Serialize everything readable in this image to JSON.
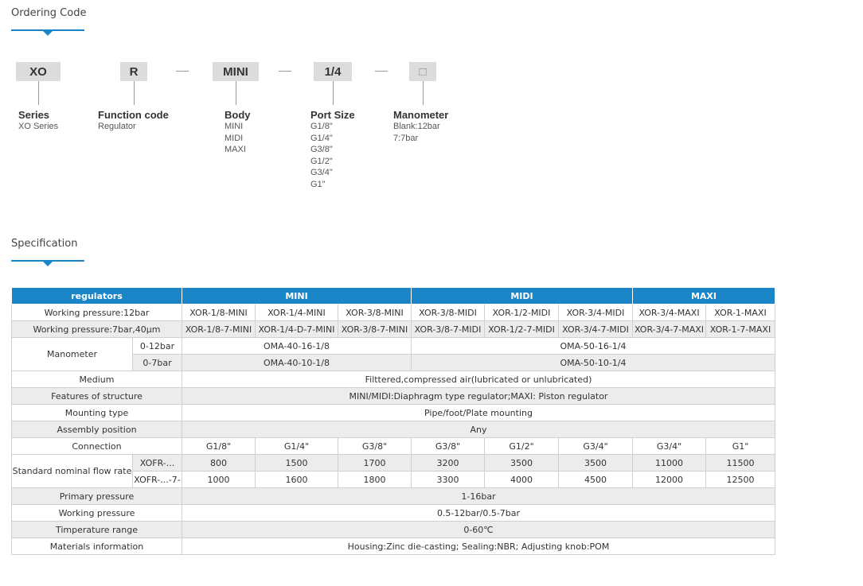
{
  "ordering": {
    "title": "Ordering Code",
    "codes": [
      "XO",
      "R",
      "MINI",
      "1/4",
      "□"
    ],
    "dashes": [
      "—",
      "—",
      "—"
    ],
    "groups": [
      {
        "heading": "Series",
        "values": [
          "XO Series"
        ]
      },
      {
        "heading": "Function code",
        "values": [
          "Regulator"
        ]
      },
      {
        "heading": "Body",
        "values": [
          "MINI",
          "MIDI",
          "MAXI"
        ]
      },
      {
        "heading": "Port Size",
        "values": [
          "G1/8\"",
          "G1/4\"",
          "G3/8\"",
          "G1/2\"",
          "G3/4\"",
          "G1\""
        ]
      },
      {
        "heading": "Manometer",
        "values": [
          "Blank:12bar",
          "7:7bar"
        ]
      }
    ]
  },
  "spec": {
    "title": "Specification",
    "header": [
      "regulators",
      "MINI",
      "MIDI",
      "MAXI"
    ],
    "working_pressure_12bar": {
      "label": "Working pressure:12bar",
      "models": [
        "XOR-1/8-MINI",
        "XOR-1/4-MINI",
        "XOR-3/8-MINI",
        "XOR-3/8-MIDI",
        "XOR-1/2-MIDI",
        "XOR-3/4-MIDI",
        "XOR-3/4-MAXI",
        "XOR-1-MAXI"
      ]
    },
    "working_pressure_7bar": {
      "label": "Working pressure:7bar,40μm",
      "models": [
        "XOR-1/8-7-MINI",
        "XOR-1/4-D-7-MINI",
        "XOR-3/8-7-MINI",
        "XOR-3/8-7-MIDI",
        "XOR-1/2-7-MIDI",
        "XOR-3/4-7-MIDI",
        "XOR-3/4-7-MAXI",
        "XOR-1-7-MAXI"
      ]
    },
    "manometer": {
      "label": "Manometer",
      "rows": [
        {
          "range": "0-12bar",
          "mini": "OMA-40-16-1/8",
          "midi_maxi": "OMA-50-16-1/4"
        },
        {
          "range": "0-7bar",
          "mini": "OMA-40-10-1/8",
          "midi_maxi": "OMA-50-10-1/4"
        }
      ]
    },
    "medium": {
      "label": "Medium",
      "value": "Filttered,compressed air(lubricated or unlubricated)"
    },
    "features": {
      "label": "Features of structure",
      "value": "MINI/MIDI:Diaphragm type regulator;MAXI: Piston regulator"
    },
    "mounting": {
      "label": "Mounting type",
      "value": "Pipe/foot/Plate mounting"
    },
    "assembly": {
      "label": "Assembly position",
      "value": "Any"
    },
    "connection": {
      "label": "Connection",
      "values": [
        "G1/8\"",
        "G1/4\"",
        "G3/8\"",
        "G3/8\"",
        "G1/2\"",
        "G3/4\"",
        "G3/4\"",
        "G1\""
      ]
    },
    "flow": {
      "label": "Standard nominal flow rate",
      "rows": [
        {
          "sub": "XOFR-...",
          "values": [
            "800",
            "1500",
            "1700",
            "3200",
            "3500",
            "3500",
            "11000",
            "11500"
          ]
        },
        {
          "sub": "XOFR-...-7-",
          "values": [
            "1000",
            "1600",
            "1800",
            "3300",
            "4000",
            "4500",
            "12000",
            "12500"
          ]
        }
      ]
    },
    "primary_pressure": {
      "label": "Primary pressure",
      "value": "1-16bar"
    },
    "working_pressure": {
      "label": "Working pressure",
      "value": "0.5-12bar/0.5-7bar"
    },
    "temperature": {
      "label": "Timperature range",
      "value": "0-60℃"
    },
    "materials": {
      "label": "Materials information",
      "value": "Housing:Zinc die-casting; Sealing:NBR; Adjusting knob:POM"
    }
  }
}
